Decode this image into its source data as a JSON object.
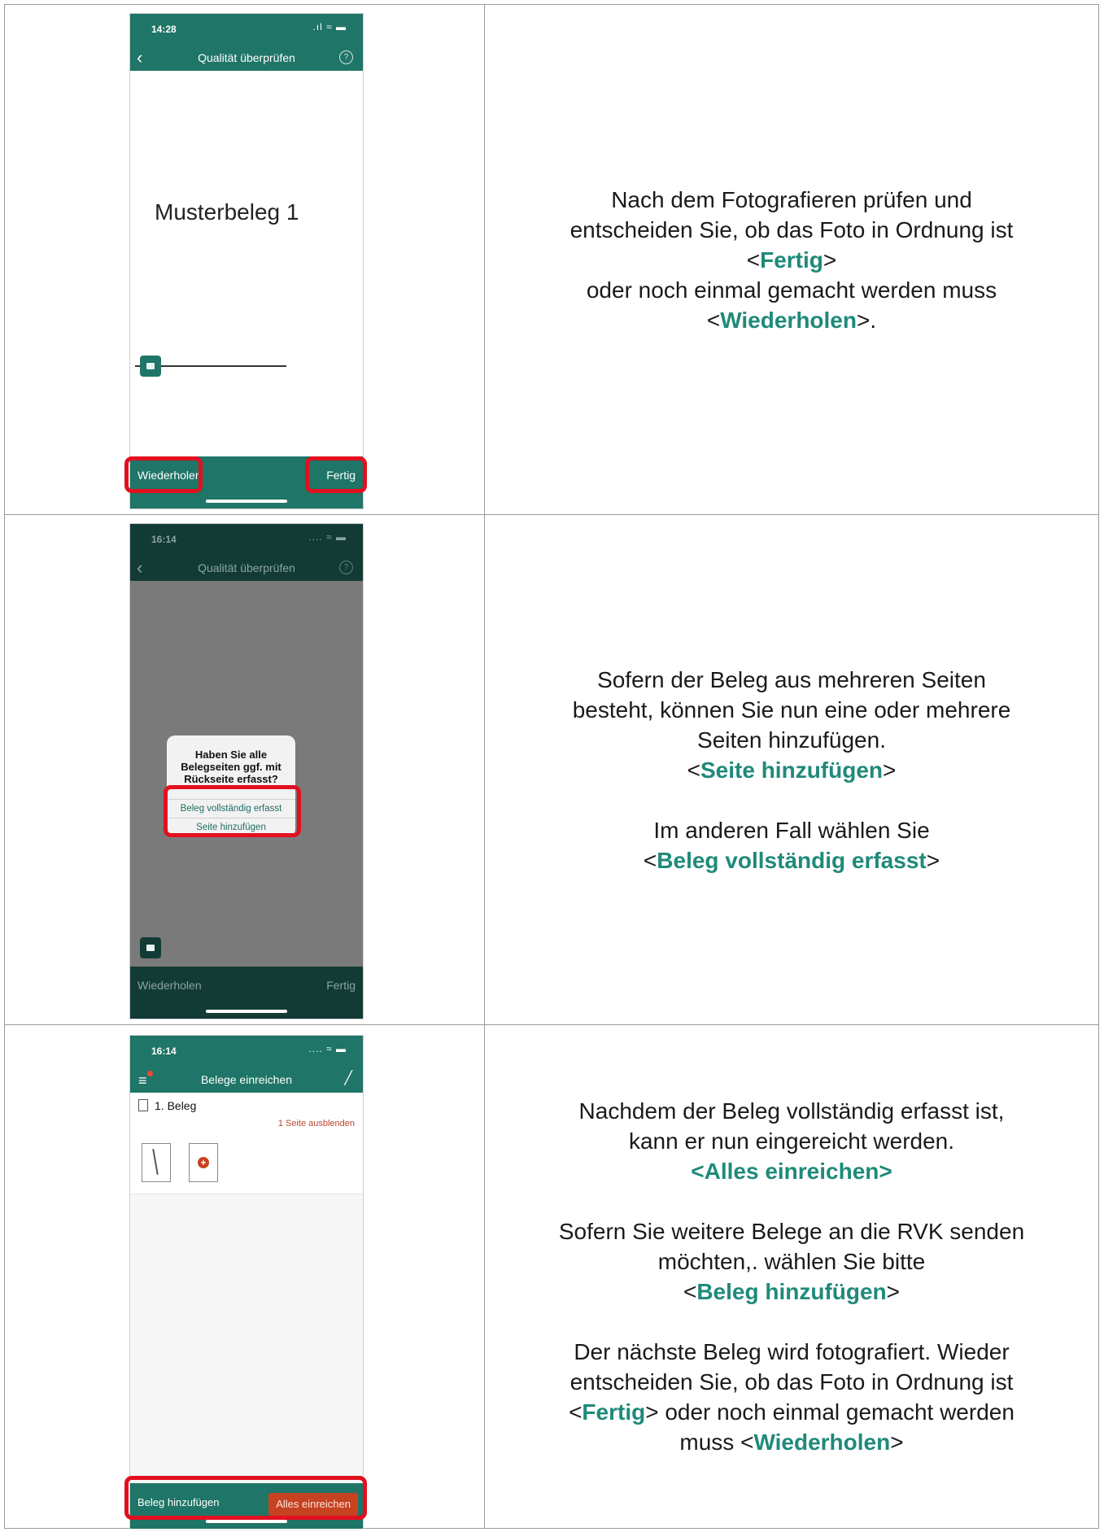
{
  "row1": {
    "phone": {
      "time": "14:28",
      "title": "Qualität überprüfen",
      "help": "?",
      "document_text": "Musterbeleg 1",
      "left_button": "Wiederholen",
      "right_button": "Fertig"
    },
    "text": {
      "line1": "Nach dem Fotografieren prüfen und",
      "line2": "entscheiden Sie, ob das Foto in Ordnung ist",
      "pre1": "<",
      "hl1": "Fertig",
      "post1": ">",
      "line3": "oder noch einmal gemacht werden muss",
      "pre2": "<",
      "hl2": "Wiederholen",
      "post2": ">."
    }
  },
  "row2": {
    "phone": {
      "time": "16:14",
      "title": "Qualität überprüfen",
      "help": "?",
      "dialog_message": "Haben Sie alle Belegseiten ggf. mit Rückseite erfasst?",
      "option1": "Beleg vollständig erfasst",
      "option2": "Seite hinzufügen",
      "left_button": "Wiederholen",
      "right_button": "Fertig"
    },
    "text": {
      "line1": "Sofern der Beleg aus mehreren Seiten",
      "line2": "besteht, können Sie nun eine oder mehrere",
      "line3": "Seiten hinzufügen.",
      "pre1": "<",
      "hl1": "Seite hinzufügen",
      "post1": ">",
      "line4": "Im anderen Fall wählen Sie",
      "pre2": "<",
      "hl2": "Beleg vollständig erfasst",
      "post2": ">"
    }
  },
  "row3": {
    "phone": {
      "time": "16:14",
      "title": "Belege einreichen",
      "item_title": "1. Beleg",
      "hide_link": "1 Seite ausblenden",
      "left_button": "Beleg hinzufügen",
      "right_button": "Alles einreichen"
    },
    "text": {
      "line1": "Nachdem der Beleg vollständig erfasst ist,",
      "line2": "kann er nun eingereicht werden.",
      "hl1": "<Alles einreichen>",
      "line3": "Sofern Sie weitere Belege an die RVK senden",
      "line4": "möchten,. wählen Sie bitte",
      "pre2": "<",
      "hl2": "Beleg hinzufügen",
      "post2": ">",
      "line5": "Der nächste Beleg wird fotografiert. Wieder",
      "line6": "entscheiden Sie, ob das Foto in Ordnung ist",
      "pre3": "<",
      "hl3": "Fertig",
      "mid3": "> oder noch einmal gemacht werden",
      "pre4": "muss <",
      "hl4": "Wiederholen",
      "post4": ">"
    }
  },
  "colors": {
    "accent": "#1f8a7a",
    "appbar": "#1f7567",
    "highlight_box": "#e3101f",
    "submit": "#c64321"
  }
}
